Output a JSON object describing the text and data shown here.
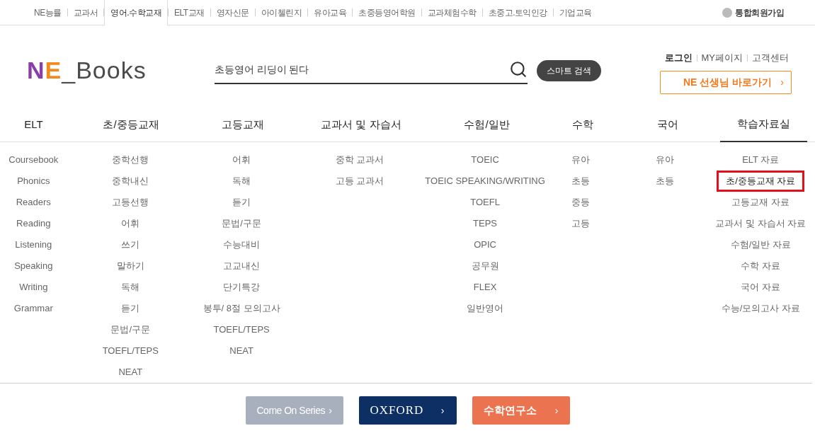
{
  "top_nav": {
    "links": [
      {
        "label": "NE능률",
        "selected": false
      },
      {
        "label": "교과서",
        "selected": false
      },
      {
        "label": "영어.수학교재",
        "selected": true
      },
      {
        "label": "ELT교재",
        "selected": false
      },
      {
        "label": "영자신문",
        "selected": false
      },
      {
        "label": "아이첼린지",
        "selected": false
      },
      {
        "label": "유아교육",
        "selected": false
      },
      {
        "label": "초중등영어학원",
        "selected": false
      },
      {
        "label": "교과체험수학",
        "selected": false
      },
      {
        "label": "초중고.토익인강",
        "selected": false
      },
      {
        "label": "기업교육",
        "selected": false
      }
    ],
    "signup": "통합회원가입"
  },
  "logo": {
    "mark": "NE",
    "name": "_Books"
  },
  "search": {
    "value": "초등영어 리딩이 된다",
    "smart_button": "스마트 검색"
  },
  "account_links": [
    "로그인",
    "MY페이지",
    "고객센터"
  ],
  "teacher_button": {
    "label": "NE 선생님 바로가기",
    "arrow": "›"
  },
  "menu": [
    {
      "title": "ELT",
      "selected": false,
      "items": [
        {
          "label": "Coursebook",
          "highlighted": false
        },
        {
          "label": "Phonics",
          "highlighted": false
        },
        {
          "label": "Readers",
          "highlighted": false
        },
        {
          "label": "Reading",
          "highlighted": false
        },
        {
          "label": "Listening",
          "highlighted": false
        },
        {
          "label": "Speaking",
          "highlighted": false
        },
        {
          "label": "Writing",
          "highlighted": false
        },
        {
          "label": "Grammar",
          "highlighted": false
        }
      ]
    },
    {
      "title": "초/중등교재",
      "selected": false,
      "items": [
        {
          "label": "중학선행",
          "highlighted": false
        },
        {
          "label": "중학내신",
          "highlighted": false
        },
        {
          "label": "고등선행",
          "highlighted": false
        },
        {
          "label": "어휘",
          "highlighted": false
        },
        {
          "label": "쓰기",
          "highlighted": false
        },
        {
          "label": "말하기",
          "highlighted": false
        },
        {
          "label": "독해",
          "highlighted": false
        },
        {
          "label": "듣기",
          "highlighted": false
        },
        {
          "label": "문법/구문",
          "highlighted": false
        },
        {
          "label": "TOEFL/TEPS",
          "highlighted": false
        },
        {
          "label": "NEAT",
          "highlighted": false
        }
      ]
    },
    {
      "title": "고등교재",
      "selected": false,
      "items": [
        {
          "label": "어휘",
          "highlighted": false
        },
        {
          "label": "독해",
          "highlighted": false
        },
        {
          "label": "듣기",
          "highlighted": false
        },
        {
          "label": "문법/구문",
          "highlighted": false
        },
        {
          "label": "수능대비",
          "highlighted": false
        },
        {
          "label": "고교내신",
          "highlighted": false
        },
        {
          "label": "단기특강",
          "highlighted": false
        },
        {
          "label": "봉투/ 8절 모의고사",
          "highlighted": false
        },
        {
          "label": "TOEFL/TEPS",
          "highlighted": false
        },
        {
          "label": "NEAT",
          "highlighted": false
        }
      ]
    },
    {
      "title": "교과서 및 자습서",
      "selected": false,
      "items": [
        {
          "label": "중학 교과서",
          "highlighted": false
        },
        {
          "label": "고등 교과서",
          "highlighted": false
        }
      ]
    },
    {
      "title": "수험/일반",
      "selected": false,
      "items": [
        {
          "label": "TOEIC",
          "highlighted": false
        },
        {
          "label": "TOEIC SPEAKING/WRITING",
          "highlighted": false
        },
        {
          "label": "TOEFL",
          "highlighted": false
        },
        {
          "label": "TEPS",
          "highlighted": false
        },
        {
          "label": "OPIC",
          "highlighted": false
        },
        {
          "label": "공무원",
          "highlighted": false
        },
        {
          "label": "FLEX",
          "highlighted": false
        },
        {
          "label": "일반영어",
          "highlighted": false
        }
      ]
    },
    {
      "title": "수학",
      "selected": false,
      "items": [
        {
          "label": "유아",
          "highlighted": false
        },
        {
          "label": "초등",
          "highlighted": false
        },
        {
          "label": "중등",
          "highlighted": false
        },
        {
          "label": "고등",
          "highlighted": false
        }
      ]
    },
    {
      "title": "국어",
      "selected": false,
      "items": [
        {
          "label": "유아",
          "highlighted": false
        },
        {
          "label": "초등",
          "highlighted": false
        }
      ]
    },
    {
      "title": "학습자료실",
      "selected": true,
      "items": [
        {
          "label": "ELT 자료",
          "highlighted": false
        },
        {
          "label": "초/중등교재 자료",
          "highlighted": true
        },
        {
          "label": "고등교재 자료",
          "highlighted": false
        },
        {
          "label": "교과서 및 자습서 자료",
          "highlighted": false
        },
        {
          "label": "수험/일반 자료",
          "highlighted": false
        },
        {
          "label": "수학 자료",
          "highlighted": false
        },
        {
          "label": "국어 자료",
          "highlighted": false
        },
        {
          "label": "수능/모의고사 자료",
          "highlighted": false
        }
      ]
    }
  ],
  "banners": [
    {
      "label": "Come On Series",
      "arrow": "›",
      "kind": "series"
    },
    {
      "label": "OXFORD",
      "arrow": "›",
      "kind": "oxford"
    },
    {
      "label": "수학연구소",
      "arrow": "›",
      "kind": "math"
    }
  ]
}
